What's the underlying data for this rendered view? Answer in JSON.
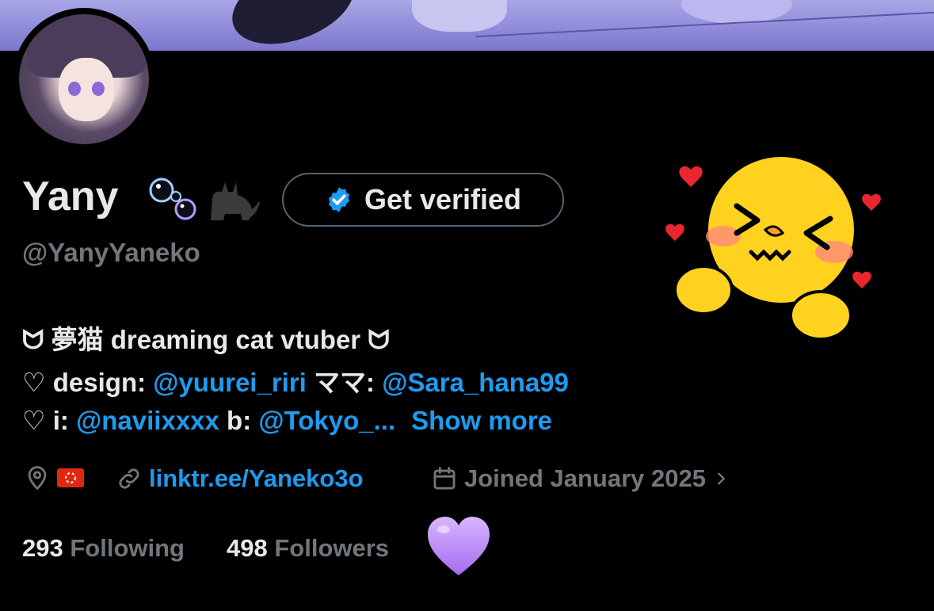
{
  "profile": {
    "name": "Yany",
    "handle": "@YanyYaneko",
    "get_verified_label": "Get verified",
    "name_emojis": [
      "bubbles-emoji",
      "black-cat-emoji"
    ],
    "sticker": "blushing-smiley-with-hearts-sticker"
  },
  "bio": {
    "line1": "ᗢ 夢猫 dreaming cat vtuber ᗢ",
    "line2_prefix": "♡ design: ",
    "line2_link1": "@yuurei_riri",
    "line2_middle": " ママ: ",
    "line2_link2": "@Sara_hana99",
    "line3_prefix": "♡ i: ",
    "line3_link1": "@naviixxxx",
    "line3_middle": " b: ",
    "line3_link2": "@Tokyo_...",
    "show_more": "Show more"
  },
  "meta": {
    "location_flag": "hong-kong-flag",
    "website": "linktr.ee/Yaneko3o",
    "joined": "Joined January 2025"
  },
  "stats": {
    "following_count": "293",
    "following_label": "Following",
    "followers_count": "498",
    "followers_label": "Followers",
    "decoration": "purple-heart-emoji"
  },
  "colors": {
    "background": "#000000",
    "text_primary": "#e7e9ea",
    "text_secondary": "#71767b",
    "link": "#1d9bf0",
    "verified_badge": "#1d9bf0",
    "button_border": "#536471"
  }
}
